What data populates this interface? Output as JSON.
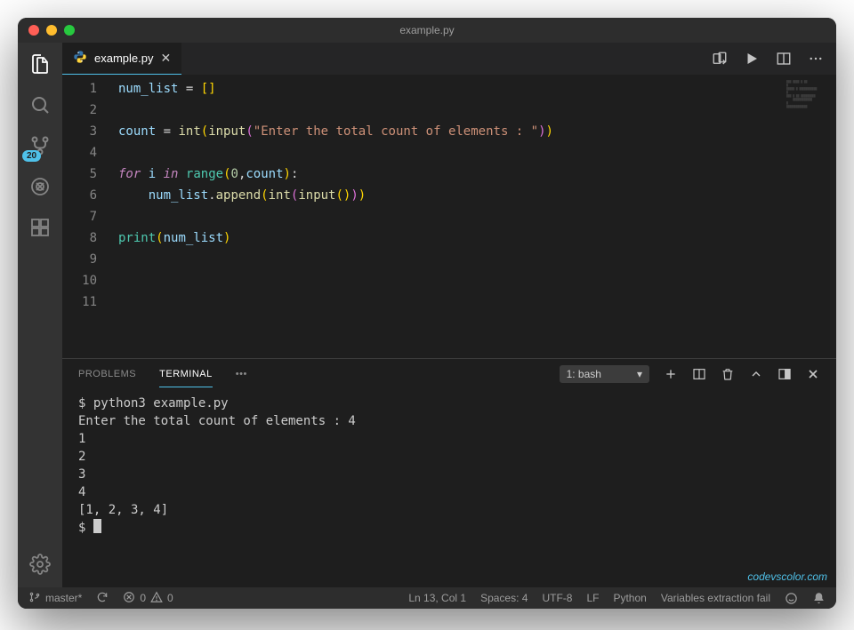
{
  "window": {
    "title": "example.py"
  },
  "tab": {
    "filename": "example.py"
  },
  "activity": {
    "scm_badge": "20"
  },
  "code_lines": [
    "num_list = []",
    "",
    "count = int(input(\"Enter the total count of elements : \"))",
    "",
    "for i in range(0,count):",
    "    num_list.append(int(input()))",
    "",
    "print(num_list)",
    "",
    "",
    ""
  ],
  "line_numbers": [
    "1",
    "2",
    "3",
    "4",
    "5",
    "6",
    "7",
    "8",
    "9",
    "10",
    "11"
  ],
  "panel": {
    "tab_problems": "PROBLEMS",
    "tab_terminal": "TERMINAL",
    "more": "•••",
    "term_name": "1: bash"
  },
  "terminal_output": [
    "$ python3 example.py",
    "Enter the total count of elements : 4",
    "1",
    "2",
    "3",
    "4",
    "[1, 2, 3, 4]"
  ],
  "terminal_prompt": "$ ",
  "watermark": "codevscolor.com",
  "status": {
    "branch": "master*",
    "errors": "0",
    "warnings": "0",
    "position": "Ln 13, Col 1",
    "spaces": "Spaces: 4",
    "encoding": "UTF-8",
    "eol": "LF",
    "language": "Python",
    "extra": "Variables extraction fail"
  }
}
